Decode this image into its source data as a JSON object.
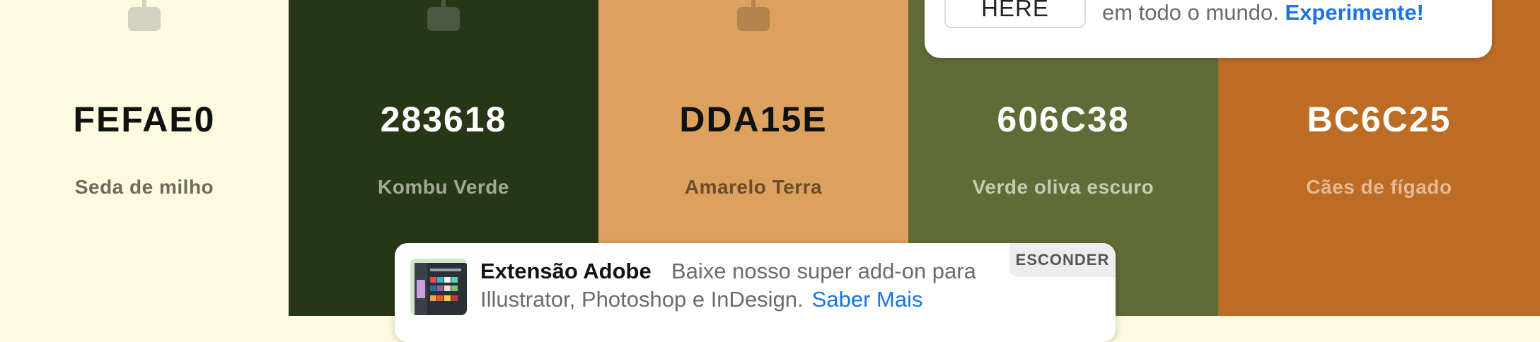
{
  "swatches": [
    {
      "hex": "FEFAE0",
      "name": "Seda de milho",
      "color": "#fefae0",
      "hex_color": "#111111",
      "name_color": "#6e6b5e",
      "lock_color": "#d3d1c0"
    },
    {
      "hex": "283618",
      "name": "Kombu Verde",
      "color": "#283618",
      "hex_color": "#ffffff",
      "name_color": "#a3a896",
      "lock_color": "#4d5840"
    },
    {
      "hex": "DDA15E",
      "name": "Amarelo Terra",
      "color": "#dda15e",
      "hex_color": "#111111",
      "name_color": "#6a4b2c",
      "lock_color": "#b58350"
    },
    {
      "hex": "606C38",
      "name": "Verde oliva escuro",
      "color": "#606c38",
      "hex_color": "#ffffff",
      "name_color": "#c7cbb2",
      "lock_color": "#7a8555"
    },
    {
      "hex": "BC6C25",
      "name": "Cães de fígado",
      "color": "#bc6c25",
      "hex_color": "#ffffff",
      "name_color": "#e7b993",
      "lock_color": "#cf8a4f"
    }
  ],
  "ad": {
    "button_label": "HERE",
    "text": "em todo o mundo.",
    "link": "Experimente!"
  },
  "banner": {
    "title": "Extensão Adobe",
    "desc1": "Baixe nosso super add-on para",
    "desc2": "Illustrator, Photoshop e InDesign.",
    "link": "Saber Mais",
    "hide_label": "ESCONDER",
    "thumbnail_icon": "adobe-extension-thumbnail"
  }
}
